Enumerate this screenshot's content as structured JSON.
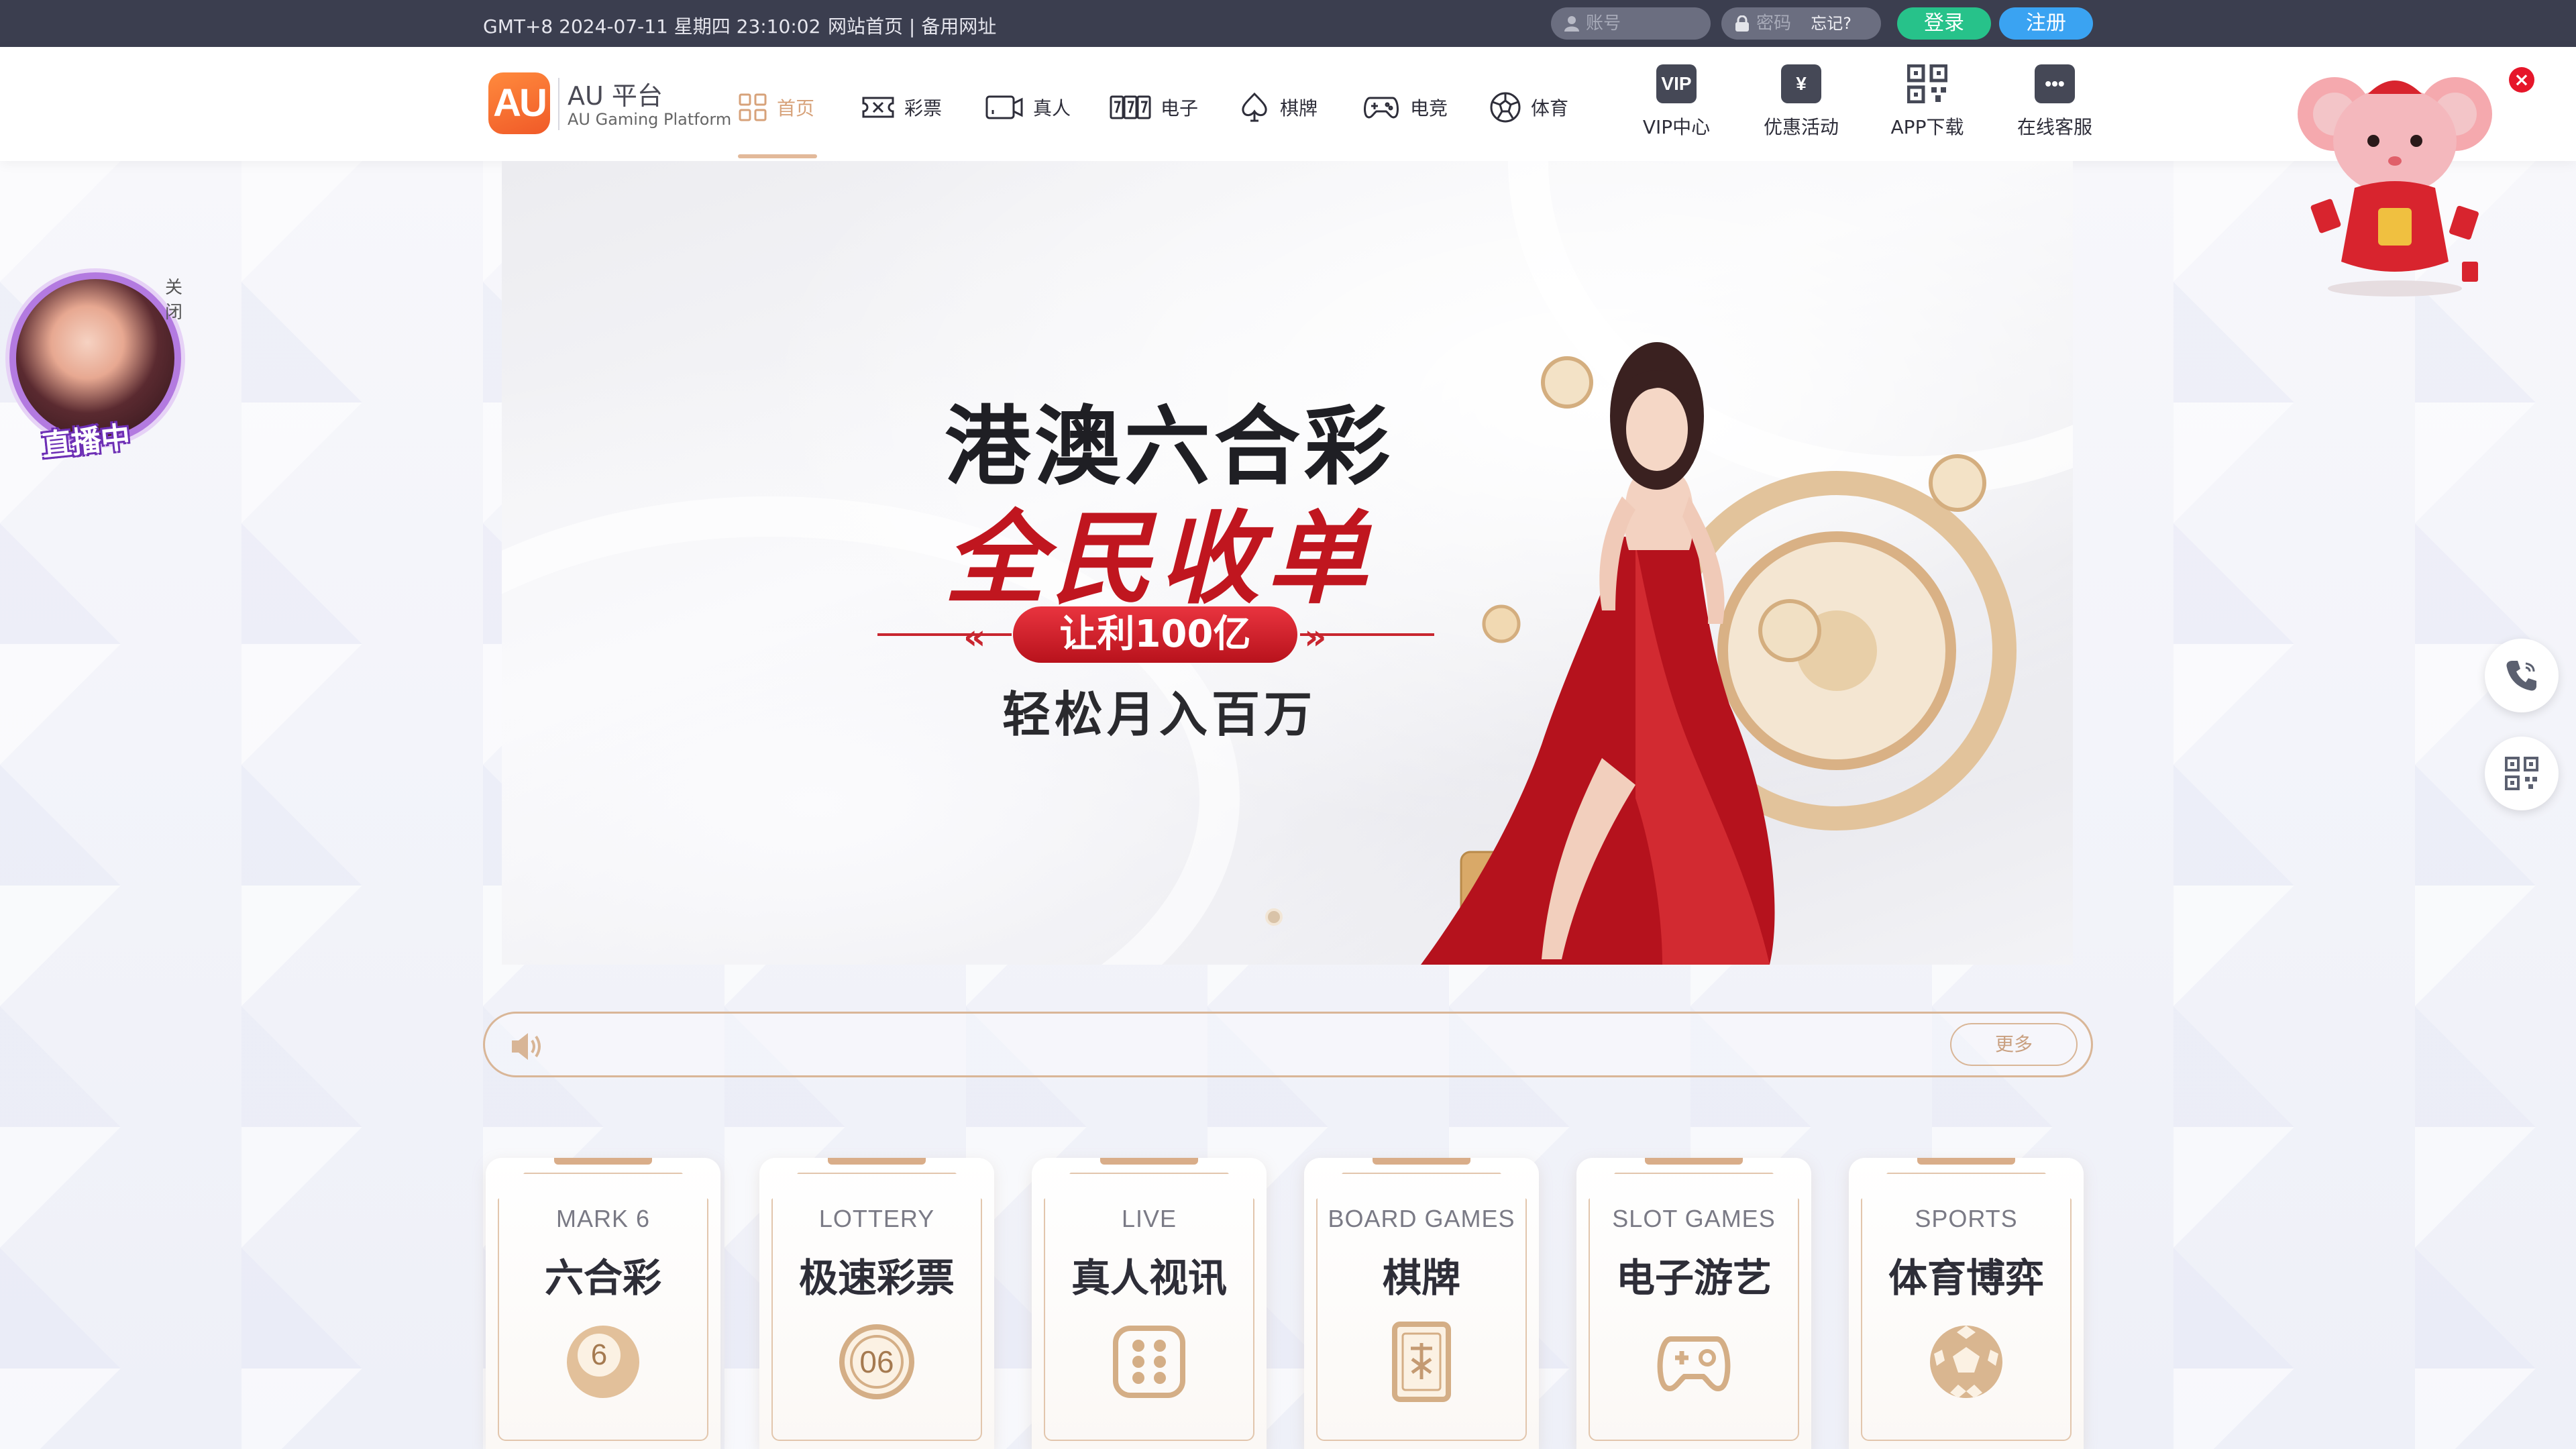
{
  "topbar": {
    "clock": "GMT+8 2024-07-11 星期四 23:10:02",
    "links": "网站首页 | 备用网址",
    "account_placeholder": "账号",
    "password_placeholder": "密码",
    "forgot_label": "忘记?",
    "login_label": "登录",
    "register_label": "注册"
  },
  "logo": {
    "mark": "AU",
    "title": "AU 平台",
    "subtitle": "AU Gaming Platform"
  },
  "nav": {
    "items": [
      {
        "label": "首页",
        "icon": "grid-icon",
        "active": true
      },
      {
        "label": "彩票",
        "icon": "lottery-ticket-icon"
      },
      {
        "label": "真人",
        "icon": "live-video-icon"
      },
      {
        "label": "电子",
        "icon": "slot-777-icon"
      },
      {
        "label": "棋牌",
        "icon": "spade-icon"
      },
      {
        "label": "电竞",
        "icon": "gamepad-icon"
      },
      {
        "label": "体育",
        "icon": "soccer-ball-icon"
      }
    ],
    "right": [
      {
        "label": "VIP中心",
        "icon": "vip-icon",
        "glyph": "VIP"
      },
      {
        "label": "优惠活动",
        "icon": "yen-gift-icon",
        "glyph": "¥"
      },
      {
        "label": "APP下载",
        "icon": "qr-code-icon",
        "glyph": ""
      },
      {
        "label": "在线客服",
        "icon": "chat-bubble-icon",
        "glyph": "•••"
      }
    ]
  },
  "banner": {
    "title": "港澳六合彩",
    "headline": "全民收单",
    "pill": "让利100亿",
    "tagline": "轻松月入百万"
  },
  "marquee": {
    "more_label": "更多"
  },
  "cards": [
    {
      "en": "MARK 6",
      "zh": "六合彩",
      "icon": "lottery-ball-6-icon"
    },
    {
      "en": "LOTTERY",
      "zh": "极速彩票",
      "icon": "lottery-ball-06-icon"
    },
    {
      "en": "LIVE",
      "zh": "真人视讯",
      "icon": "dice-icon"
    },
    {
      "en": "BOARD GAMES",
      "zh": "棋牌",
      "icon": "mahjong-tile-icon"
    },
    {
      "en": "SLOT GAMES",
      "zh": "电子游艺",
      "icon": "gamepad-icon"
    },
    {
      "en": "SPORTS",
      "zh": "体育博弈",
      "icon": "soccer-ball-icon"
    }
  ],
  "live_float": {
    "close_label": "关闭",
    "badge": "直播中"
  },
  "colors": {
    "topbar_bg": "#3b3e4f",
    "accent_gold": "#d9ad89",
    "login_green": "#27c28a",
    "register_blue": "#3aa3f2",
    "banner_red": "#c0161f"
  }
}
